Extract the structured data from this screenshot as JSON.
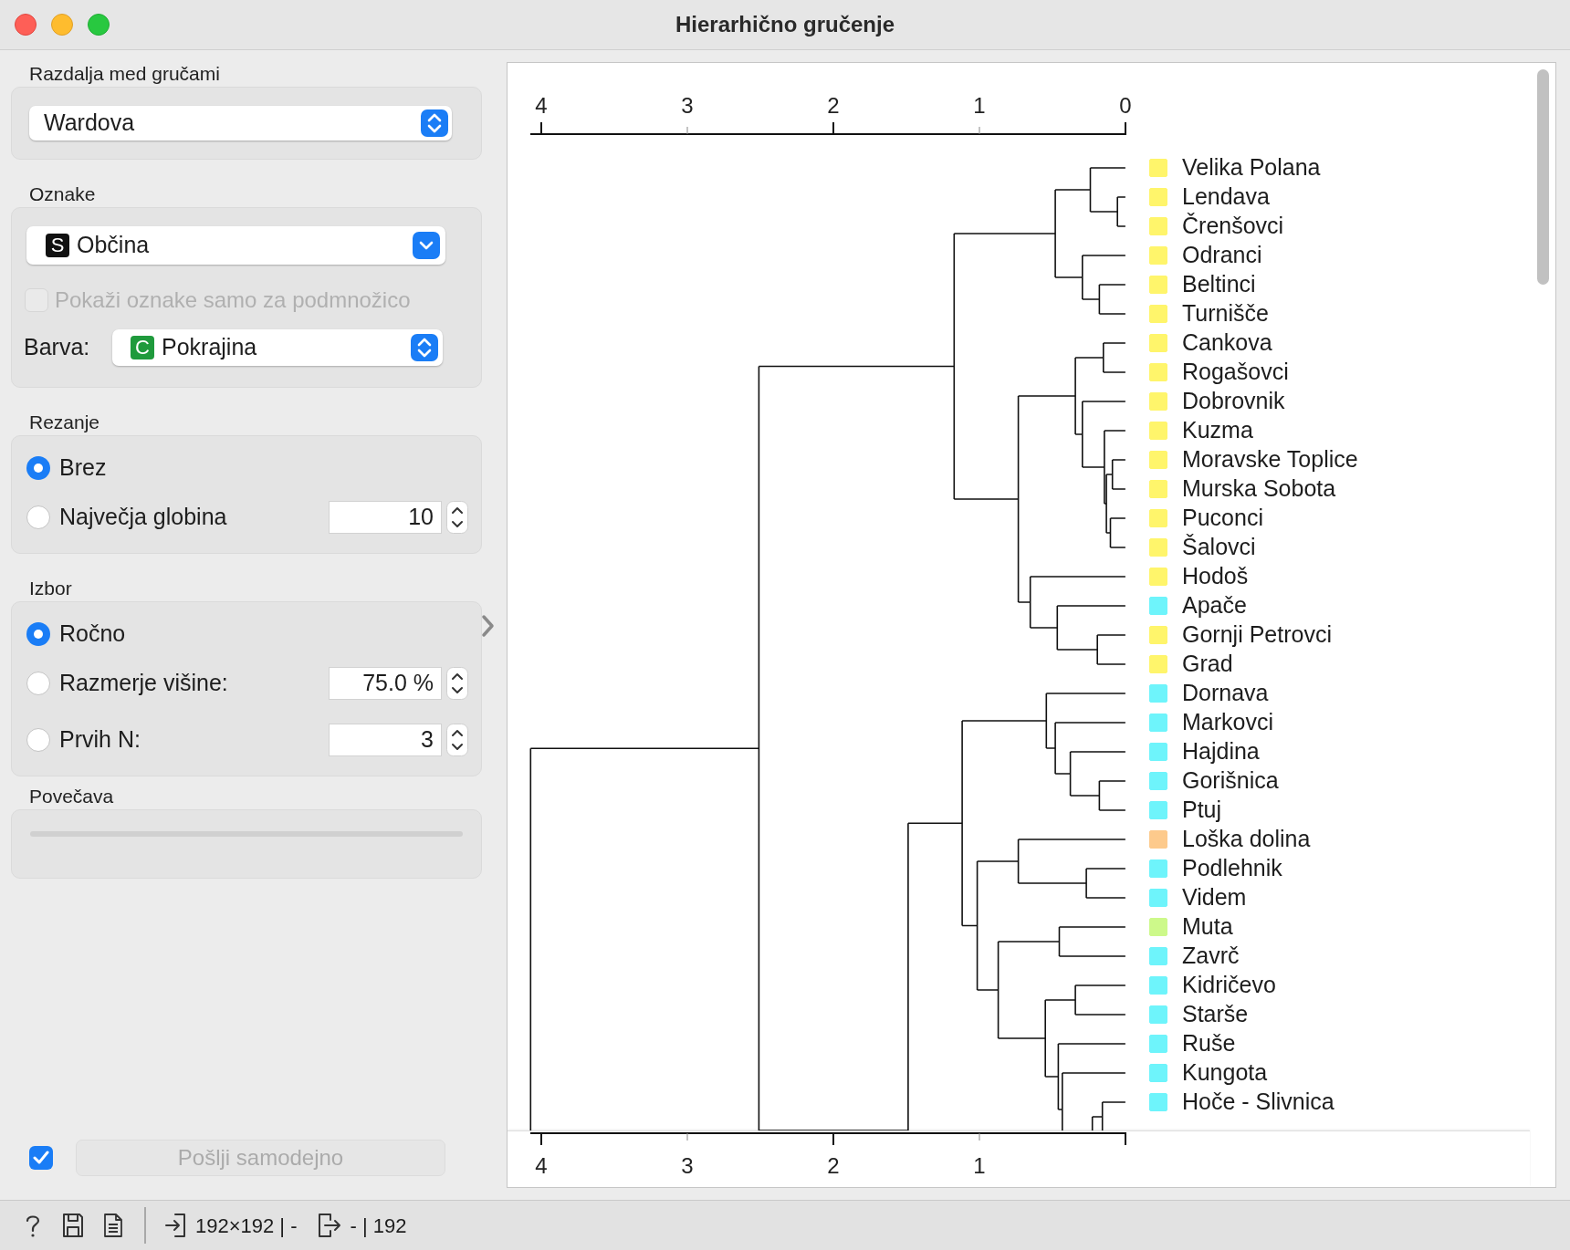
{
  "window": {
    "title": "Hierarhično gručenje"
  },
  "sidebar": {
    "linkage": {
      "heading": "Razdalja med gručami",
      "value": "Wardova"
    },
    "labels": {
      "heading": "Oznake",
      "label_attribute": {
        "kind": "string",
        "badge": "S",
        "name": "Občina"
      },
      "subset_checkbox": {
        "label": "Pokaži oznake samo za podmnožico",
        "checked": false,
        "disabled": true
      },
      "color_label": "Barva:",
      "color_attribute": {
        "kind": "categorical",
        "badge": "C",
        "name": "Pokrajina"
      }
    },
    "pruning": {
      "heading": "Rezanje",
      "options": [
        {
          "label": "Brez",
          "selected": true
        },
        {
          "label": "Največja globina",
          "selected": false,
          "value": "10"
        }
      ]
    },
    "selection": {
      "heading": "Izbor",
      "options": [
        {
          "label": "Ročno",
          "selected": true
        },
        {
          "label": "Razmerje višine:",
          "selected": false,
          "value": "75.0 %"
        },
        {
          "label": "Prvih N:",
          "selected": false,
          "value": "3"
        }
      ]
    },
    "zoom": {
      "heading": "Povečava"
    },
    "auto_send": {
      "checked": true,
      "label": "Pošlji samodejno",
      "disabled": true
    }
  },
  "dendrogram": {
    "top_axis_ticks": [
      "4",
      "3",
      "2",
      "1",
      "0"
    ],
    "bottom_axis_ticks": [
      "4",
      "3",
      "2",
      "1"
    ],
    "leaves": [
      {
        "label": "Velika Polana",
        "color": "#fff56b"
      },
      {
        "label": "Lendava",
        "color": "#fff56b"
      },
      {
        "label": "Črenšovci",
        "color": "#fff56b"
      },
      {
        "label": "Odranci",
        "color": "#fff56b"
      },
      {
        "label": "Beltinci",
        "color": "#fff56b"
      },
      {
        "label": "Turnišče",
        "color": "#fff56b"
      },
      {
        "label": "Cankova",
        "color": "#fff56b"
      },
      {
        "label": "Rogašovci",
        "color": "#fff56b"
      },
      {
        "label": "Dobrovnik",
        "color": "#fff56b"
      },
      {
        "label": "Kuzma",
        "color": "#fff56b"
      },
      {
        "label": "Moravske Toplice",
        "color": "#fff56b"
      },
      {
        "label": "Murska Sobota",
        "color": "#fff56b"
      },
      {
        "label": "Puconci",
        "color": "#fff56b"
      },
      {
        "label": "Šalovci",
        "color": "#fff56b"
      },
      {
        "label": "Hodoš",
        "color": "#fff56b"
      },
      {
        "label": "Apače",
        "color": "#6ef4fb"
      },
      {
        "label": "Gornji Petrovci",
        "color": "#fff56b"
      },
      {
        "label": "Grad",
        "color": "#fff56b"
      },
      {
        "label": "Dornava",
        "color": "#6ef4fb"
      },
      {
        "label": "Markovci",
        "color": "#6ef4fb"
      },
      {
        "label": "Hajdina",
        "color": "#6ef4fb"
      },
      {
        "label": "Gorišnica",
        "color": "#6ef4fb"
      },
      {
        "label": "Ptuj",
        "color": "#6ef4fb"
      },
      {
        "label": "Loška dolina",
        "color": "#fdca8c"
      },
      {
        "label": "Podlehnik",
        "color": "#6ef4fb"
      },
      {
        "label": "Videm",
        "color": "#6ef4fb"
      },
      {
        "label": "Muta",
        "color": "#cdf98a"
      },
      {
        "label": "Zavrč",
        "color": "#6ef4fb"
      },
      {
        "label": "Kidričevo",
        "color": "#6ef4fb"
      },
      {
        "label": "Starše",
        "color": "#6ef4fb"
      },
      {
        "label": "Ruše",
        "color": "#6ef4fb"
      },
      {
        "label": "Kungota",
        "color": "#6ef4fb"
      },
      {
        "label": "Hoče - Slivnica",
        "color": "#6ef4fb"
      }
    ]
  },
  "status_bar": {
    "input": "192×192 | -",
    "output": "- | 192"
  }
}
